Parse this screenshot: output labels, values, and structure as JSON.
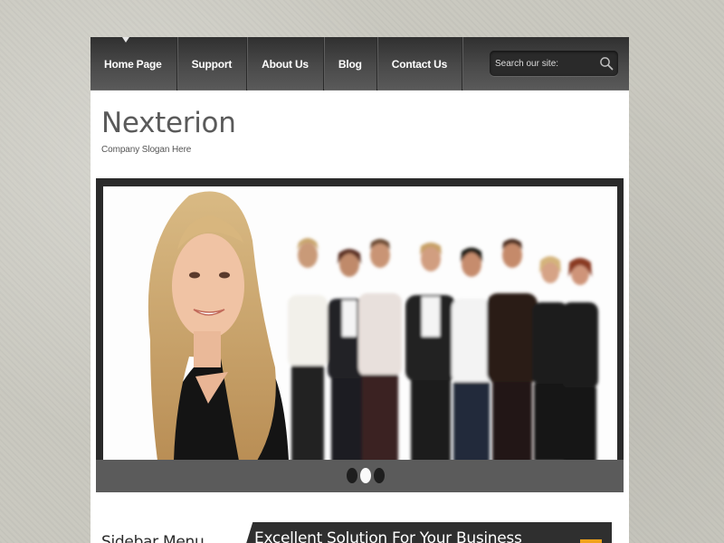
{
  "nav": {
    "items": [
      {
        "label": "Home Page",
        "active": true
      },
      {
        "label": "Support"
      },
      {
        "label": "About Us"
      },
      {
        "label": "Blog"
      },
      {
        "label": "Contact Us"
      }
    ],
    "search_placeholder": "Search our site:"
  },
  "site": {
    "logo": "Nexterion",
    "slogan": "Company Slogan Here"
  },
  "slider": {
    "slide_count": 3,
    "active_index": 1
  },
  "sidebar": {
    "title": "Sidebar Menu"
  },
  "feature": {
    "title": "Excellent Solution For Your Business"
  },
  "colors": {
    "nav_bg": "#404040",
    "slider_frame": "#2a2a2a",
    "slider_bar": "#5b5b5b",
    "accent": "#f1a31c"
  }
}
